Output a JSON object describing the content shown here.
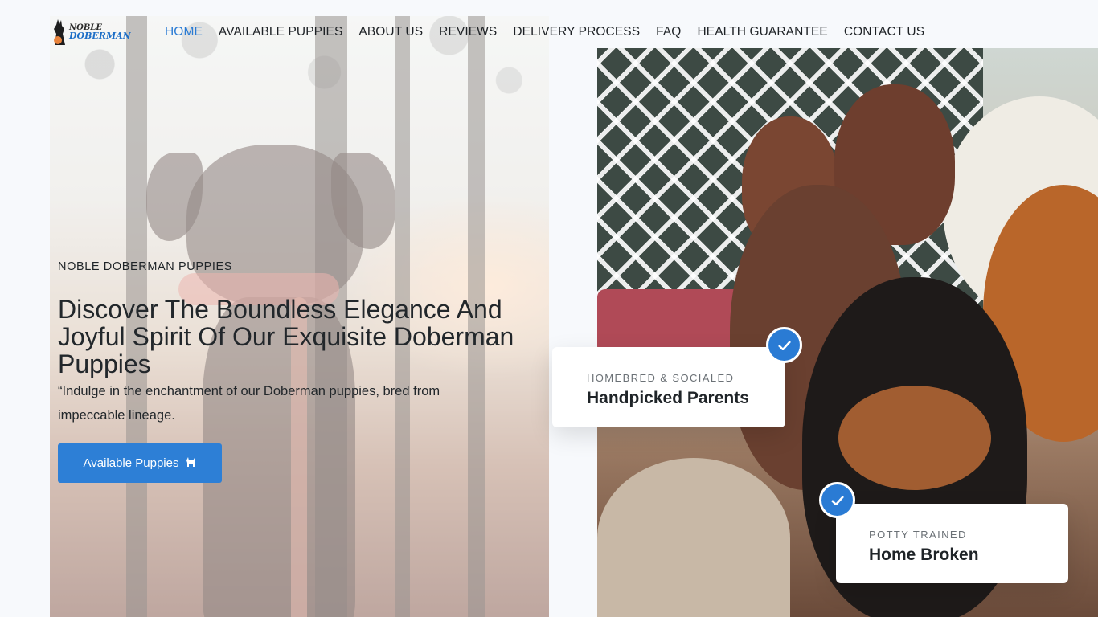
{
  "brand": {
    "logo_line1": "NOBLE",
    "logo_line2": "DOBERMAN"
  },
  "nav": {
    "items": [
      {
        "label": "HOME",
        "active": true
      },
      {
        "label": "AVAILABLE PUPPIES"
      },
      {
        "label": "ABOUT US"
      },
      {
        "label": "REVIEWS"
      },
      {
        "label": "DELIVERY PROCESS"
      },
      {
        "label": "FAQ"
      },
      {
        "label": "HEALTH GUARANTEE"
      },
      {
        "label": "CONTACT US"
      }
    ]
  },
  "hero": {
    "eyebrow": "NOBLE DOBERMAN PUPPIES",
    "title": "Discover The Boundless Elegance And Joyful Spirit Of Our Exquisite Doberman Puppies",
    "subtitle": "“Indulge in the enchantment of our Doberman puppies, bred from impeccable lineage.",
    "cta_label": "Available Puppies",
    "cta_icon": "dog-icon"
  },
  "features": [
    {
      "label": "HOMEBRED & SOCIALED",
      "value": "Handpicked Parents",
      "icon": "check-icon"
    },
    {
      "label": "POTTY TRAINED",
      "value": "Home Broken",
      "icon": "check-icon"
    }
  ],
  "colors": {
    "accent": "#2d7fd6",
    "text": "#1f2428"
  }
}
